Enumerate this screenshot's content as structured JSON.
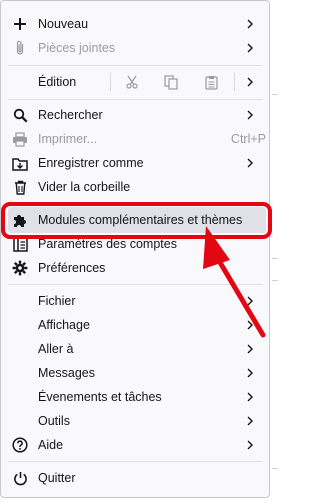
{
  "menu": {
    "new": {
      "label": "Nouveau",
      "icon": "plus-icon"
    },
    "attachments": {
      "label": "Pièces jointes",
      "icon": "paperclip-icon"
    },
    "edit": {
      "label": "Édition",
      "icons": [
        "scissors-icon",
        "copy-icon",
        "paste-icon"
      ]
    },
    "find": {
      "label": "Rechercher",
      "icon": "search-icon"
    },
    "print": {
      "label": "Imprimer...",
      "shortcut": "Ctrl+P",
      "icon": "printer-icon"
    },
    "save_as": {
      "label": "Enregistrer comme",
      "icon": "save-folder-icon"
    },
    "empty_trash": {
      "label": "Vider la corbeille",
      "icon": "trash-icon"
    },
    "addons": {
      "label": "Modules complémentaires et thèmes",
      "icon": "puzzle-icon"
    },
    "account_settings": {
      "label": "Paramètres des comptes",
      "icon": "account-settings-icon"
    },
    "preferences": {
      "label": "Préférences",
      "icon": "gear-icon"
    },
    "file": {
      "label": "Fichier"
    },
    "view": {
      "label": "Affichage"
    },
    "go": {
      "label": "Aller à"
    },
    "messages": {
      "label": "Messages"
    },
    "events_tasks": {
      "label": "Évenements et tâches"
    },
    "tools": {
      "label": "Outils"
    },
    "help": {
      "label": "Aide",
      "icon": "help-icon"
    },
    "quit": {
      "label": "Quitter",
      "icon": "power-icon"
    }
  },
  "colors": {
    "menu_bg": "#f9f9fb",
    "hover_bg": "#e0e0e8",
    "annotation_red": "#e30613",
    "text": "#15141a",
    "disabled_text": "#9a9aa0"
  }
}
